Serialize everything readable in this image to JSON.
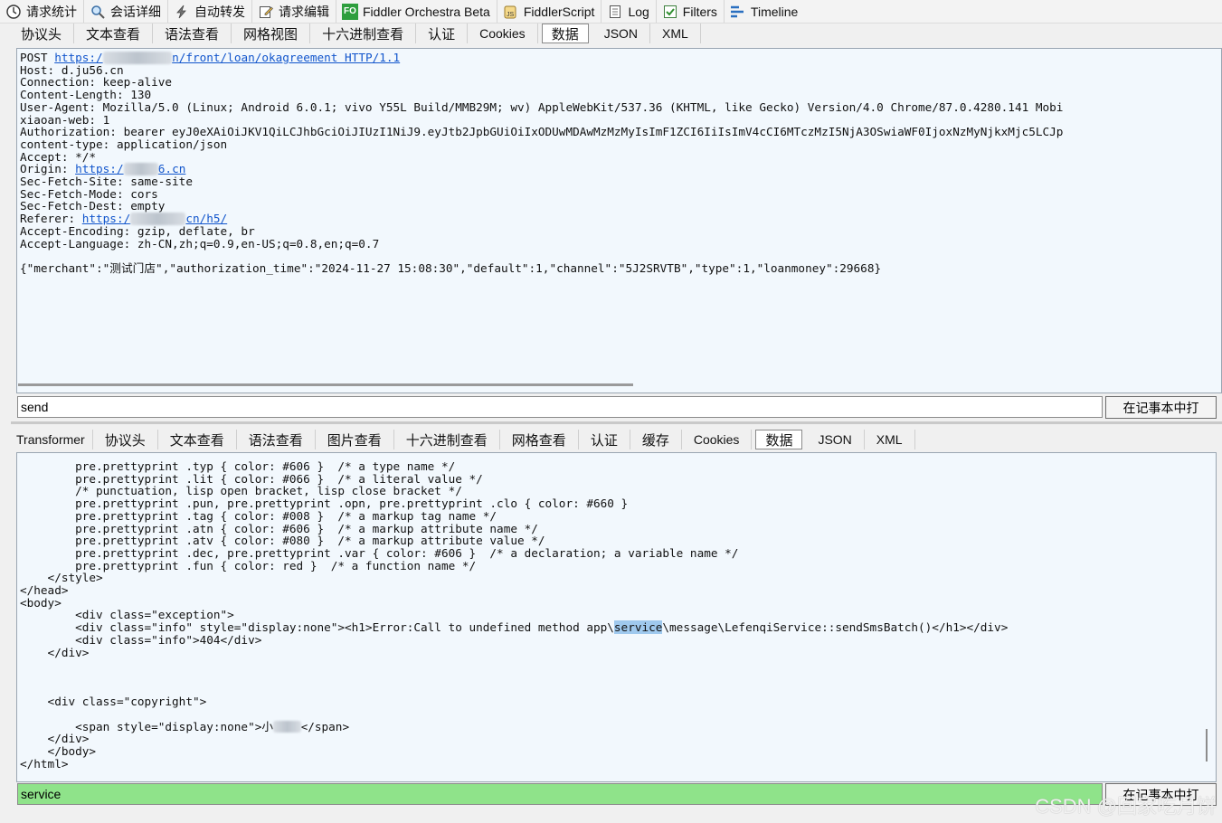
{
  "toolbar": {
    "items": [
      {
        "icon": "clock-icon",
        "label": "请求统计"
      },
      {
        "icon": "magnifier-icon",
        "label": "会话详细"
      },
      {
        "icon": "lightning-icon",
        "label": "自动转发"
      },
      {
        "icon": "edit-icon",
        "label": "请求编辑"
      },
      {
        "icon": "fo-icon",
        "label": "Fiddler Orchestra Beta"
      },
      {
        "icon": "script-icon",
        "label": "FiddlerScript"
      },
      {
        "icon": "log-icon",
        "label": "Log"
      },
      {
        "icon": "filter-check-icon",
        "label": "Filters"
      },
      {
        "icon": "timeline-icon",
        "label": "Timeline"
      }
    ]
  },
  "request": {
    "tabs": [
      "协议头",
      "文本查看",
      "语法查看",
      "网格视图",
      "十六进制查看",
      "认证",
      "Cookies",
      "数据",
      "JSON",
      "XML"
    ],
    "active_tab": "数据",
    "method": "POST ",
    "url_start": "https:/",
    "url_end": "n/front/loan/okagreement HTTP/1.1",
    "headers": [
      "Host: d.ju56.cn",
      "Connection: keep-alive",
      "Content-Length: 130",
      "User-Agent: Mozilla/5.0 (Linux; Android 6.0.1; vivo Y55L Build/MMB29M; wv) AppleWebKit/537.36 (KHTML, like Gecko) Version/4.0 Chrome/87.0.4280.141 Mobi",
      "xiaoan-web: 1",
      "Authorization: bearer eyJ0eXAiOiJKV1QiLCJhbGciOiJIUzI1NiJ9.eyJtb2JpbGUiOiIxODUwMDAwMzMzMyIsImF1ZCI6IiIsImV4cCI6MTczMzI5NjA3OSwiaWF0IjoxNzMyNjkxMjc5LCJp",
      "content-type: application/json",
      "Accept: */*"
    ],
    "origin_label": "Origin: ",
    "origin_start": "https:/",
    "origin_end": "6.cn",
    "sec_headers": [
      "Sec-Fetch-Site: same-site",
      "Sec-Fetch-Mode: cors",
      "Sec-Fetch-Dest: empty"
    ],
    "referer_label": "Referer: ",
    "referer_start": "https:/",
    "referer_end": "cn/h5/",
    "tail_headers": [
      "Accept-Encoding: gzip, deflate, br",
      "Accept-Language: zh-CN,zh;q=0.9,en-US;q=0.8,en;q=0.7"
    ],
    "body": "{\"merchant\":\"测试门店\",\"authorization_time\":\"2024-11-27 15:08:30\",\"default\":1,\"channel\":\"5J2SRVTB\",\"type\":1,\"loanmoney\":29668}",
    "find_value": "send",
    "find_button": "在记事本中打"
  },
  "response": {
    "tabs": [
      "Transformer",
      "协议头",
      "文本查看",
      "语法查看",
      "图片查看",
      "十六进制查看",
      "网格查看",
      "认证",
      "缓存",
      "Cookies",
      "数据",
      "JSON",
      "XML"
    ],
    "active_tab": "数据",
    "lines_top": [
      "        pre.prettyprint .typ { color: #606 }  /* a type name */",
      "        pre.prettyprint .lit { color: #066 }  /* a literal value */",
      "        /* punctuation, lisp open bracket, lisp close bracket */",
      "        pre.prettyprint .pun, pre.prettyprint .opn, pre.prettyprint .clo { color: #660 }",
      "        pre.prettyprint .tag { color: #008 }  /* a markup tag name */",
      "        pre.prettyprint .atn { color: #606 }  /* a markup attribute name */",
      "        pre.prettyprint .atv { color: #080 }  /* a markup attribute value */",
      "        pre.prettyprint .dec, pre.prettyprint .var { color: #606 }  /* a declaration; a variable name */",
      "        pre.prettyprint .fun { color: red }  /* a function name */",
      "    </style>",
      "</head>",
      "<body>"
    ],
    "line_exception": "        <div class=\"exception\">",
    "error_pre": "        <div class=\"info\" style=\"display:none\"><h1>Error:Call to undefined method app\\",
    "error_hl": "service",
    "error_post": "\\message\\LefenqiService::sendSmsBatch()</h1></div>",
    "line_404": "        <div class=\"info\">404</div>",
    "line_enddiv": "    </div>",
    "line_copyright": "    <div class=\"copyright\">",
    "span_pre": "        <span style=\"display:none\">小",
    "span_post": "</span>",
    "lines_bottom": [
      "    </div>",
      "    </body>",
      "</html>"
    ],
    "find_value": "service",
    "find_button": "在记事本中打",
    "find_color": "#8fe38a"
  },
  "watermark": "CSDN @回家吃月饼"
}
